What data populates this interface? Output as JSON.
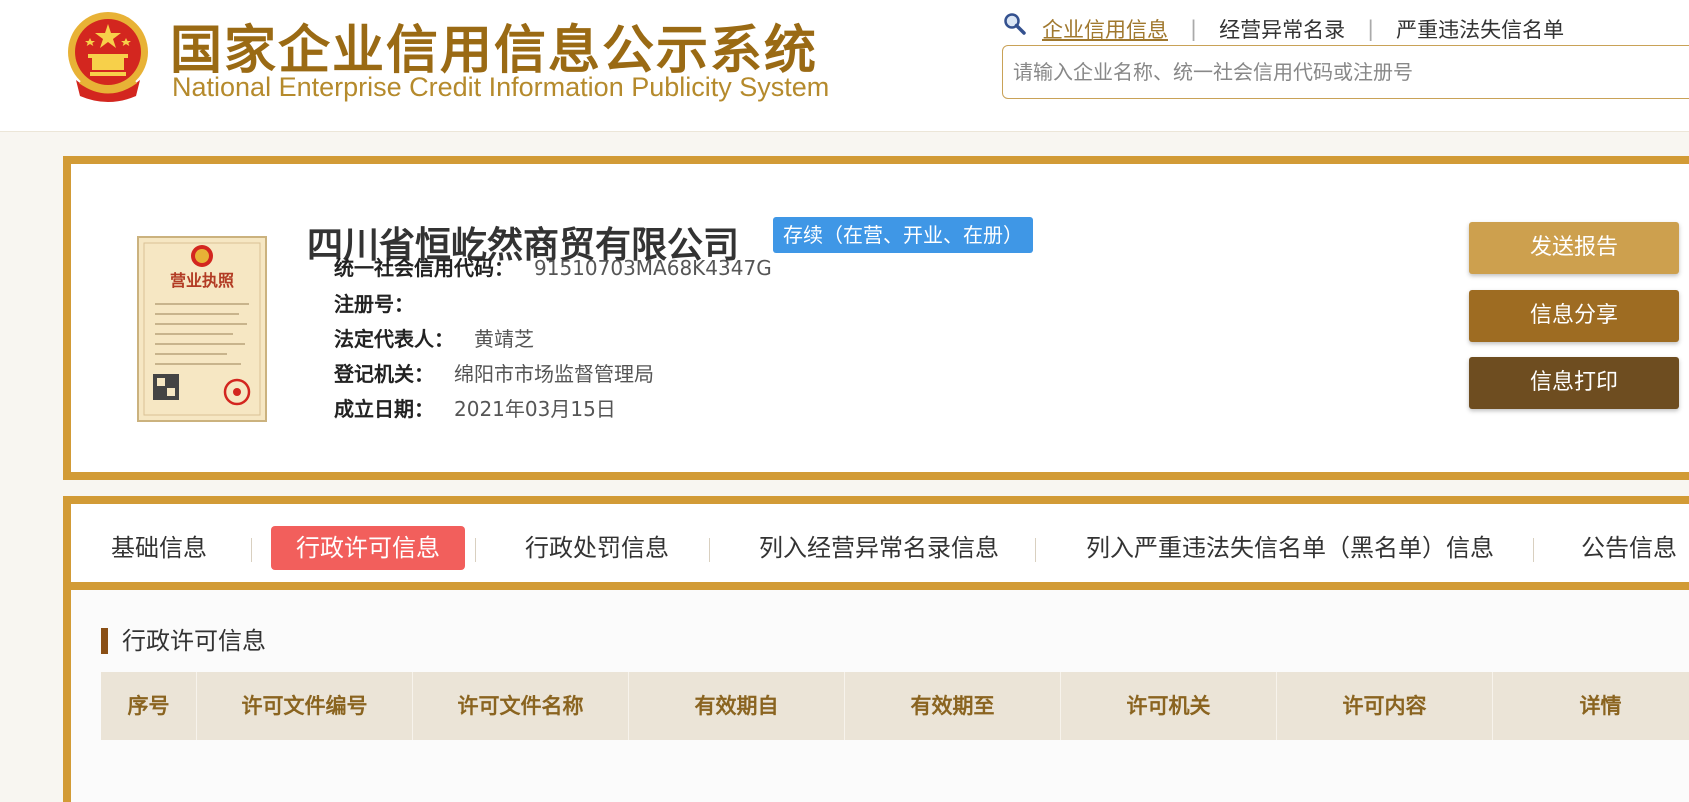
{
  "header": {
    "title_cn": "国家企业信用信息公示系统",
    "title_en": "National Enterprise Credit Information Publicity System",
    "nav_links": [
      "企业信用信息",
      "经营异常名录",
      "严重违法失信名单"
    ],
    "search_placeholder": "请输入企业名称、统一社会信用代码或注册号",
    "search_value": ""
  },
  "company": {
    "name": "四川省恒屹然商贸有限公司",
    "status": "存续（在营、开业、在册）",
    "info": [
      {
        "label": "统一社会信用代码：",
        "value": "91510703MA68K4347G"
      },
      {
        "label": "注册号：",
        "value": ""
      },
      {
        "label": "法定代表人：",
        "value": "黄靖芝"
      },
      {
        "label": "登记机关：",
        "value": "绵阳市市场监督管理局"
      },
      {
        "label": "成立日期：",
        "value": "2021年03月15日"
      }
    ],
    "license_title": "营业执照"
  },
  "actions": {
    "send_report": "发送报告",
    "share": "信息分享",
    "print": "信息打印"
  },
  "tabs": [
    "基础信息",
    "行政许可信息",
    "行政处罚信息",
    "列入经营异常名录信息",
    "列入严重违法失信名单（黑名单）信息",
    "公告信息"
  ],
  "active_tab": "行政许可信息",
  "section": {
    "title": "行政许可信息",
    "columns": [
      "序号",
      "许可文件编号",
      "许可文件名称",
      "有效期自",
      "有效期至",
      "许可机关",
      "许可内容",
      "详情"
    ]
  },
  "colors": {
    "gold_border": "#d29b36",
    "title_brown": "#9a6a14",
    "status_blue": "#3f97e6",
    "active_tab_red": "#f25f5c",
    "btn_send": "#cda04e",
    "btn_share": "#9e6c22",
    "btn_print": "#6e4d20"
  }
}
